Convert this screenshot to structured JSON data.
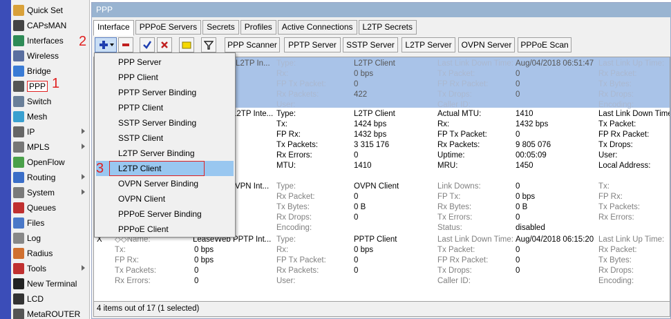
{
  "sidebar": {
    "items": [
      {
        "label": "Quick Set",
        "icon": "quick-set-icon",
        "color": "#d9a13a"
      },
      {
        "label": "CAPsMAN",
        "icon": "capsman-icon",
        "color": "#444"
      },
      {
        "label": "Interfaces",
        "icon": "interfaces-icon",
        "color": "#2e8b57"
      },
      {
        "label": "Wireless",
        "icon": "wireless-icon",
        "color": "#5a6fa0"
      },
      {
        "label": "Bridge",
        "icon": "bridge-icon",
        "color": "#3a7bd5"
      },
      {
        "label": "PPP",
        "icon": "ppp-icon",
        "color": "#555"
      },
      {
        "label": "Switch",
        "icon": "switch-icon",
        "color": "#6a7f99"
      },
      {
        "label": "Mesh",
        "icon": "mesh-icon",
        "color": "#3aa0d0"
      },
      {
        "label": "IP",
        "icon": "ip-icon",
        "color": "#666",
        "submenu": true
      },
      {
        "label": "MPLS",
        "icon": "mpls-icon",
        "color": "#777",
        "submenu": true
      },
      {
        "label": "OpenFlow",
        "icon": "openflow-icon",
        "color": "#4aa04a"
      },
      {
        "label": "Routing",
        "icon": "routing-icon",
        "color": "#3b6ec8",
        "submenu": true
      },
      {
        "label": "System",
        "icon": "system-icon",
        "color": "#7a7a7a",
        "submenu": true
      },
      {
        "label": "Queues",
        "icon": "queues-icon",
        "color": "#c03030"
      },
      {
        "label": "Files",
        "icon": "files-icon",
        "color": "#4a78c8"
      },
      {
        "label": "Log",
        "icon": "log-icon",
        "color": "#888"
      },
      {
        "label": "Radius",
        "icon": "radius-icon",
        "color": "#d07030"
      },
      {
        "label": "Tools",
        "icon": "tools-icon",
        "color": "#c03030",
        "submenu": true
      },
      {
        "label": "New Terminal",
        "icon": "terminal-icon",
        "color": "#222"
      },
      {
        "label": "LCD",
        "icon": "lcd-icon",
        "color": "#333"
      },
      {
        "label": "MetaROUTER",
        "icon": "metarouter-icon",
        "color": "#555"
      }
    ]
  },
  "annotations": {
    "step1": "1",
    "step2": "2",
    "step3": "3"
  },
  "window": {
    "title": "PPP",
    "tabs": [
      "Interface",
      "PPPoE Servers",
      "Secrets",
      "Profiles",
      "Active Connections",
      "L2TP Secrets"
    ],
    "toolbar_buttons": [
      "PPP Scanner",
      "PPTP Server",
      "SSTP Server",
      "L2TP Server",
      "OVPN Server",
      "PPPoE Scan"
    ],
    "footer": "4 items out of 17 (1 selected)"
  },
  "dropdown": {
    "items": [
      "PPP Server",
      "PPP Client",
      "PPTP Server Binding",
      "PPTP Client",
      "SSTP Server Binding",
      "SSTP Client",
      "L2TP Server Binding",
      "L2TP Client",
      "OVPN Server Binding",
      "OVPN Client",
      "PPPoE Server Binding",
      "PPPoE Client"
    ],
    "highlighted": "L2TP Client"
  },
  "grid": {
    "rows": [
      {
        "name": "L2TP In...",
        "col2": [
          [
            "Type:",
            "L2TP Client"
          ],
          [
            "Rx:",
            "0 bps"
          ],
          [
            "FP Tx Packet:",
            "0"
          ],
          [
            "Rx Packets:",
            "422"
          ],
          [
            "User:",
            ""
          ]
        ],
        "col3": [
          [
            "Last Link Down Time:",
            "Aug/04/2018 06:51:47"
          ],
          [
            "Tx Packet:",
            "0"
          ],
          [
            "FP Rx Packet:",
            "0"
          ],
          [
            "Tx Drops:",
            "0"
          ],
          [
            "Caller ID:",
            ""
          ]
        ],
        "col4": [
          "Last Link Up Time:",
          "Rx Packet:",
          "Tx Bytes:",
          "Rx Drops:",
          "Encoding:"
        ]
      },
      {
        "name": "L2TP Inte...",
        "col2": [
          [
            "Type:",
            "L2TP Client"
          ],
          [
            "Tx:",
            "1424 bps"
          ],
          [
            "FP Rx:",
            "1432 bps"
          ],
          [
            "Tx Packets:",
            "3 315 176"
          ],
          [
            "Rx Errors:",
            "0"
          ],
          [
            "MTU:",
            "1410"
          ]
        ],
        "col3": [
          [
            "Actual MTU:",
            "1410"
          ],
          [
            "Rx:",
            "1432 bps"
          ],
          [
            "FP Tx Packet:",
            "0"
          ],
          [
            "Rx Packets:",
            "9 805 076"
          ],
          [
            "Uptime:",
            "00:05:09"
          ],
          [
            "MRU:",
            "1450"
          ]
        ],
        "col4": [
          "Last Link Down Time:",
          "Tx Packet:",
          "FP Rx Packet:",
          "Tx Drops:",
          "User:",
          "Local Address:"
        ]
      },
      {
        "name": "OVPN Int...",
        "col2": [
          [
            "Type:",
            "OVPN Client"
          ],
          [
            "Rx Packet:",
            "0"
          ],
          [
            "Tx Bytes:",
            "0 B"
          ],
          [
            "Rx Drops:",
            "0"
          ],
          [
            "Encoding:",
            ""
          ]
        ],
        "col3": [
          [
            "Link Downs:",
            "0"
          ],
          [
            "FP Tx:",
            "0 bps"
          ],
          [
            "Rx Bytes:",
            "0 B"
          ],
          [
            "Tx Errors:",
            "0"
          ],
          [
            "Status:",
            "disabled"
          ]
        ],
        "col4": [
          "Tx:",
          "FP Rx:",
          "Tx Packets:",
          "Rx Errors:"
        ]
      },
      {
        "flag": "X",
        "name_label": "◇◇Name:",
        "name": "LeaseWeb PPTP Int...",
        "col1": [
          [
            "Tx:",
            "0 bps"
          ],
          [
            "FP Rx:",
            "0 bps"
          ],
          [
            "Tx Packets:",
            "0"
          ],
          [
            "Rx Errors:",
            "0"
          ]
        ],
        "col2": [
          [
            "Type:",
            "PPTP Client"
          ],
          [
            "Rx:",
            "0 bps"
          ],
          [
            "FP Tx Packet:",
            "0"
          ],
          [
            "Rx Packets:",
            "0"
          ],
          [
            "User:",
            ""
          ]
        ],
        "col3": [
          [
            "Last Link Down Time:",
            "Aug/04/2018 06:15:20"
          ],
          [
            "Tx Packet:",
            "0"
          ],
          [
            "FP Rx Packet:",
            "0"
          ],
          [
            "Tx Drops:",
            "0"
          ],
          [
            "Caller ID:",
            ""
          ]
        ],
        "col4": [
          "Last Link Up Time:",
          "Rx Packet:",
          "Tx Bytes:",
          "Rx Drops:",
          "Encoding:"
        ]
      }
    ]
  }
}
